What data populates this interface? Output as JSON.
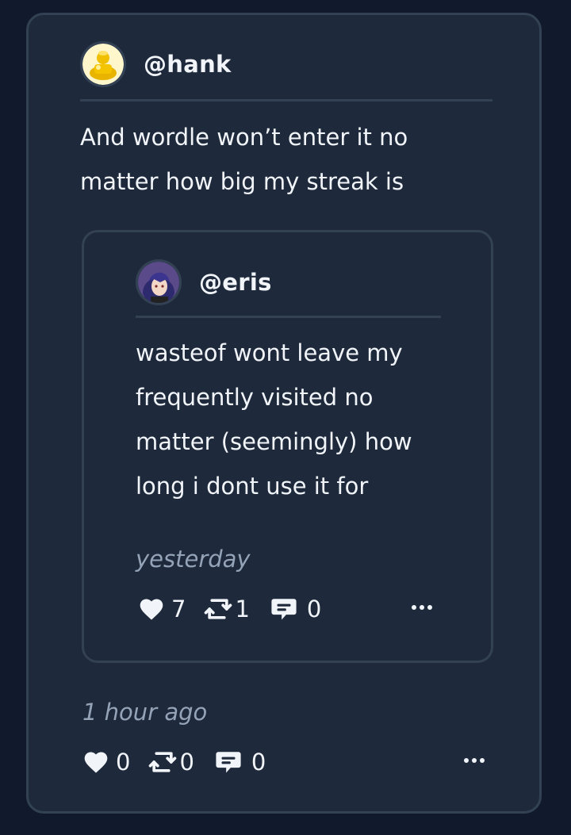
{
  "post": {
    "username": "@hank",
    "text_lines": [
      "And wordle won’t enter it no",
      "matter how big my streak is"
    ],
    "timestamp": "1 hour ago",
    "likes": "0",
    "reposts": "0",
    "comments": "0"
  },
  "quoted": {
    "username": "@eris",
    "text_lines": [
      "wasteof wont leave my",
      "frequently visited no",
      "matter (seemingly) how",
      "long i dont use it for"
    ],
    "timestamp": "yesterday",
    "likes": "7",
    "reposts": "1",
    "comments": "0"
  },
  "icons": {
    "like": "heart-icon",
    "repost": "repost-icon",
    "comment": "comment-icon",
    "more": "more-icon"
  },
  "colors": {
    "background": "#101a2c",
    "card": "#1e293b",
    "border": "#334155",
    "text": "#f1f5f9",
    "muted": "#94a3b8"
  }
}
